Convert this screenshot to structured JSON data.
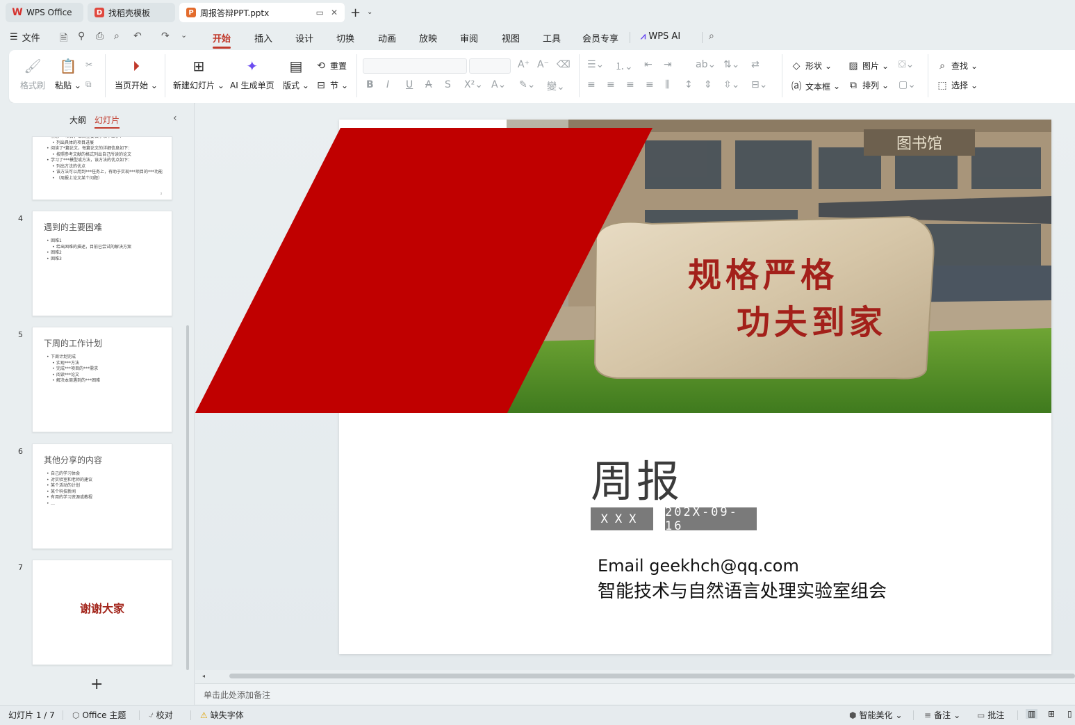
{
  "tabs": [
    {
      "label": "WPS Office"
    },
    {
      "label": "找稻壳模板"
    },
    {
      "label": "周报答辩PPT.pptx"
    }
  ],
  "menu": {
    "file": "文件",
    "items": [
      "开始",
      "插入",
      "设计",
      "切换",
      "动画",
      "放映",
      "审阅",
      "视图",
      "工具",
      "会员专享",
      "WPS AI"
    ]
  },
  "ribbon": {
    "format_painter": "格式刷",
    "paste": "粘贴",
    "from_current": "当页开始",
    "new_slide": "新建幻灯片",
    "ai_single": "AI 生成单页",
    "layout": "版式",
    "reset": "重置",
    "section": "节",
    "shape": "形状",
    "picture": "图片",
    "textbox": "文本框",
    "arrange": "排列",
    "find": "查找",
    "select": "选择"
  },
  "left_panel": {
    "tab_outline": "大纲",
    "tab_slides": "幻灯片",
    "slides": [
      {
        "num": "",
        "title": "",
        "bullets": [
          {
            "text": "熟悉***项目，本周主要做了以下工作：",
            "sub": false
          },
          {
            "text": "列出具体的项目进展",
            "sub": true
          },
          {
            "text": "阅读了*篇论文，每篇论文的详细信息如下：",
            "sub": false
          },
          {
            "text": "按照参考文献的格式列出自己所读的论文",
            "sub": true
          },
          {
            "text": "学习了***模型或方法，该方法的优点如下：",
            "sub": false
          },
          {
            "text": "列出方法的优点",
            "sub": true
          },
          {
            "text": "该方法可以用到***任务上，有助于实现***项目的***功能",
            "sub": true
          },
          {
            "text": "（周报上论文某个问题）",
            "sub": true
          }
        ]
      },
      {
        "num": "4",
        "title": "遇到的主要困难",
        "bullets": [
          {
            "text": "困难1",
            "sub": false
          },
          {
            "text": "给出困难的描述，目前已尝试的解决方案",
            "sub": true
          },
          {
            "text": "困难2",
            "sub": false
          },
          {
            "text": "困难3",
            "sub": false
          }
        ]
      },
      {
        "num": "5",
        "title": "下周的工作计划",
        "bullets": [
          {
            "text": "下周计划完成",
            "sub": false
          },
          {
            "text": "实现***方法",
            "sub": true
          },
          {
            "text": "完成***项目的***需求",
            "sub": true
          },
          {
            "text": "阅读***论文",
            "sub": true
          },
          {
            "text": "解决本周遇到的***困难",
            "sub": true
          }
        ]
      },
      {
        "num": "6",
        "title": "其他分享的内容",
        "bullets": [
          {
            "text": "自己的学习体会",
            "sub": false
          },
          {
            "text": "对实验室和老师的建议",
            "sub": false
          },
          {
            "text": "某个活动的计划",
            "sub": false
          },
          {
            "text": "某个科技新闻",
            "sub": false
          },
          {
            "text": "有用的学习资源或教程",
            "sub": false
          },
          {
            "text": "…",
            "sub": false
          }
        ]
      },
      {
        "num": "7",
        "title": "谢谢大家",
        "bullets": []
      }
    ]
  },
  "slide": {
    "title": "周报",
    "name_tag": "XXX",
    "date_tag": "202X-09-16",
    "email_line": "Email  geekhch@qq.com",
    "lab_line": "智能技术与自然语言处理实验室组会",
    "image_stone_text_1": "规格严格",
    "image_stone_text_2": "功夫到家",
    "image_building_sign": "图书馆",
    "accent_color": "#c00000"
  },
  "notes_placeholder": "单击此处添加备注",
  "status": {
    "slide_counter": "幻灯片 1 / 7",
    "theme": "Office 主题",
    "proofread": "校对",
    "missing_font": "缺失字体",
    "beautify": "智能美化",
    "notes": "备注",
    "comments": "批注"
  }
}
